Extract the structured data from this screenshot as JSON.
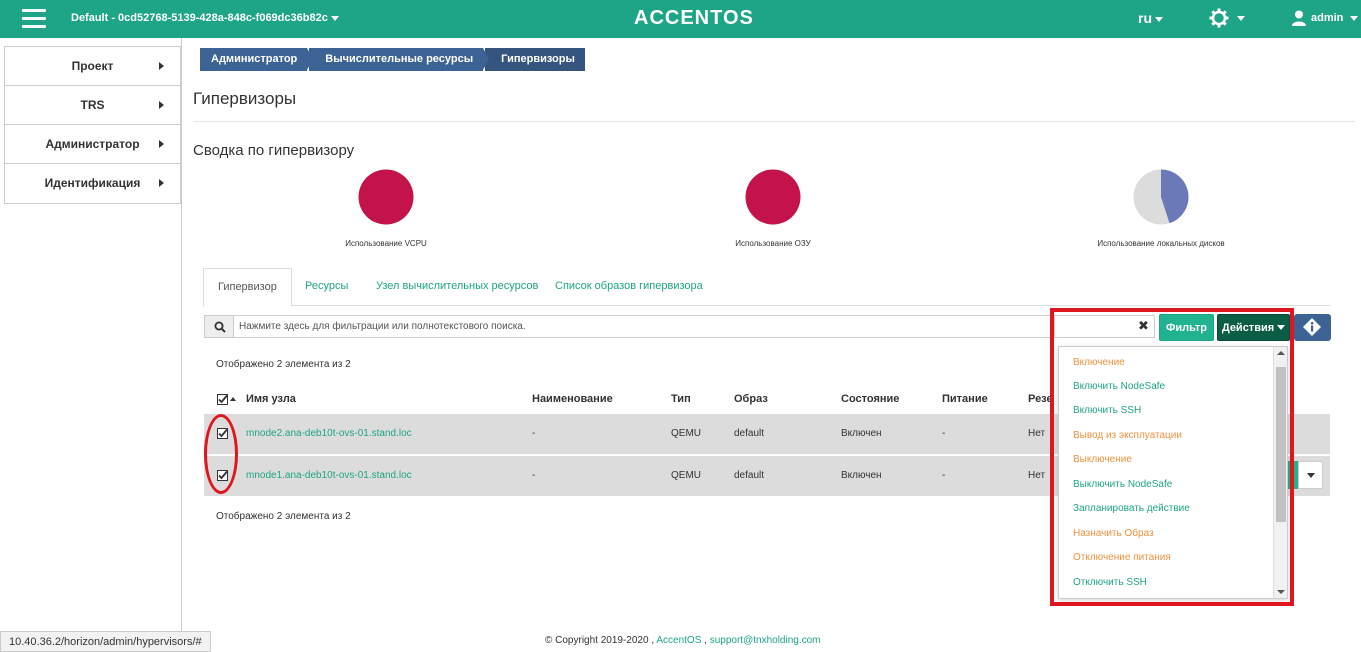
{
  "header": {
    "project": "Default - 0cd52768-5139-428a-848c-f069dc36b82c",
    "brand": "ACCENTOS",
    "language": "ru",
    "user": "admin",
    "bar_color": "#1ea486"
  },
  "sidebar": {
    "items": [
      {
        "label": "Проект"
      },
      {
        "label": "TRS"
      },
      {
        "label": "Администратор"
      },
      {
        "label": "Идентификация"
      }
    ]
  },
  "breadcrumb": [
    "Администратор",
    "Вычислительные ресурсы",
    "Гипервизоры"
  ],
  "page_title": "Гипервизоры",
  "summary": {
    "title": "Сводка по гипервизору",
    "charts": [
      {
        "label": "Использование VCPU",
        "used_fraction": 1.0,
        "color": "#c4124b"
      },
      {
        "label": "Использование ОЗУ",
        "used_fraction": 1.0,
        "color": "#c4124b"
      },
      {
        "label": "Использование локальных дисков",
        "used_fraction": 0.45,
        "color": "#6b79b8",
        "rest_color": "#dcdcdc"
      }
    ]
  },
  "tabs": [
    "Гипервизор",
    "Ресурсы",
    "Узел вычислительных ресурсов",
    "Список образов гипервизора"
  ],
  "search": {
    "placeholder": "Нажмите здесь для фильтрации или полнотекстового поиска.",
    "clear": "✖",
    "filter_label": "Фильтр",
    "actions_label": "Действия"
  },
  "table": {
    "count_top": "Отображено 2 элемента из 2",
    "count_bottom": "Отображено 2 элемента из 2",
    "columns": [
      "Имя узла",
      "Наименование",
      "Тип",
      "Образ",
      "Состояние",
      "Питание",
      "Резе"
    ],
    "rows": [
      {
        "host": "mnode2.ana-deb10t-ovs-01.stand.loc",
        "name": "-",
        "type": "QEMU",
        "image": "default",
        "state": "Включен",
        "power": "-",
        "reserve": "Нет"
      },
      {
        "host": "mnode1.ana-deb10t-ovs-01.stand.loc",
        "name": "-",
        "type": "QEMU",
        "image": "default",
        "state": "Включен",
        "power": "-",
        "reserve": "Нет"
      }
    ]
  },
  "actions_menu": [
    {
      "label": "Включение",
      "color": "#f0913d"
    },
    {
      "label": "Включить NodeSafe",
      "color": "#1ea486"
    },
    {
      "label": "Включить SSH",
      "color": "#1ea486"
    },
    {
      "label": "Вывод из эксплуатации",
      "color": "#f0913d"
    },
    {
      "label": "Выключение",
      "color": "#f0913d"
    },
    {
      "label": "Выключить NodeSafe",
      "color": "#1ea486"
    },
    {
      "label": "Запланировать действие",
      "color": "#1ea486"
    },
    {
      "label": "Назначить Образ",
      "color": "#f0913d"
    },
    {
      "label": "Отключение питания",
      "color": "#f0913d"
    },
    {
      "label": "Отключить SSH",
      "color": "#1ea486"
    }
  ],
  "status_url": "10.40.36.2/horizon/admin/hypervisors/#",
  "footer": {
    "copyright": "© Copyright 2019-2020 ,",
    "brand_link": "AccentOS",
    "sep": ",",
    "email": "support@tnxholding.com"
  }
}
